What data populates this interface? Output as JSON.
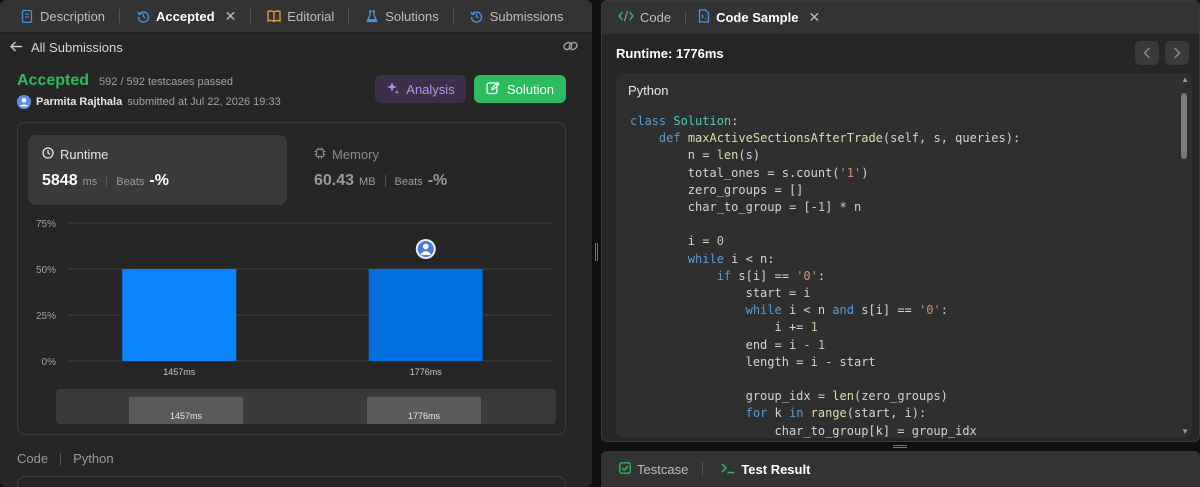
{
  "left_tabs": [
    {
      "label": "Description",
      "icon": "document-icon",
      "color": "#4a90e2"
    },
    {
      "label": "Accepted",
      "icon": "history-icon",
      "color": "#4a90e2",
      "active": true
    },
    {
      "label": "Editorial",
      "icon": "book-icon",
      "color": "#e8a33d"
    },
    {
      "label": "Solutions",
      "icon": "flask-icon",
      "color": "#4a90e2"
    },
    {
      "label": "Submissions",
      "icon": "history-icon",
      "color": "#4a90e2"
    }
  ],
  "subbar": {
    "back_label": "All Submissions"
  },
  "submission": {
    "status": "Accepted",
    "testcases": "592 / 592 testcases passed",
    "author": "Parmita Rajthala",
    "submitted_at": "submitted at Jul 22, 2026 19:33"
  },
  "buttons": {
    "analysis": "Analysis",
    "solution": "Solution"
  },
  "runtime_card": {
    "title": "Runtime",
    "value": "5848",
    "unit": "ms",
    "beats_label": "Beats",
    "beats_value": "-%"
  },
  "memory_card": {
    "title": "Memory",
    "value": "60.43",
    "unit": "MB",
    "beats_label": "Beats",
    "beats_value": "-%"
  },
  "chart_data": {
    "type": "bar",
    "categories": [
      "1457ms",
      "1776ms"
    ],
    "values": [
      50,
      50
    ],
    "ylim": [
      0,
      75
    ],
    "yticks": [
      "0%",
      "25%",
      "50%",
      "75%"
    ],
    "ytick_values": [
      0,
      25,
      50,
      75
    ],
    "highlight_index": 1,
    "minimap_labels": [
      "1457ms",
      "1776ms"
    ],
    "colors": {
      "bar": "#0a84ff",
      "highlight": "#0070e0"
    }
  },
  "code_footer": {
    "label": "Code",
    "lang": "Python"
  },
  "right_tabs": [
    {
      "label": "Code",
      "icon": "code-icon"
    },
    {
      "label": "Code Sample",
      "icon": "file-icon",
      "active": true
    }
  ],
  "code_sample": {
    "runtime": "Runtime: 1776ms",
    "language": "Python"
  },
  "bottom_tabs": [
    {
      "label": "Testcase",
      "icon": "check-box-icon"
    },
    {
      "label": "Test Result",
      "icon": "terminal-icon",
      "active": true
    }
  ]
}
